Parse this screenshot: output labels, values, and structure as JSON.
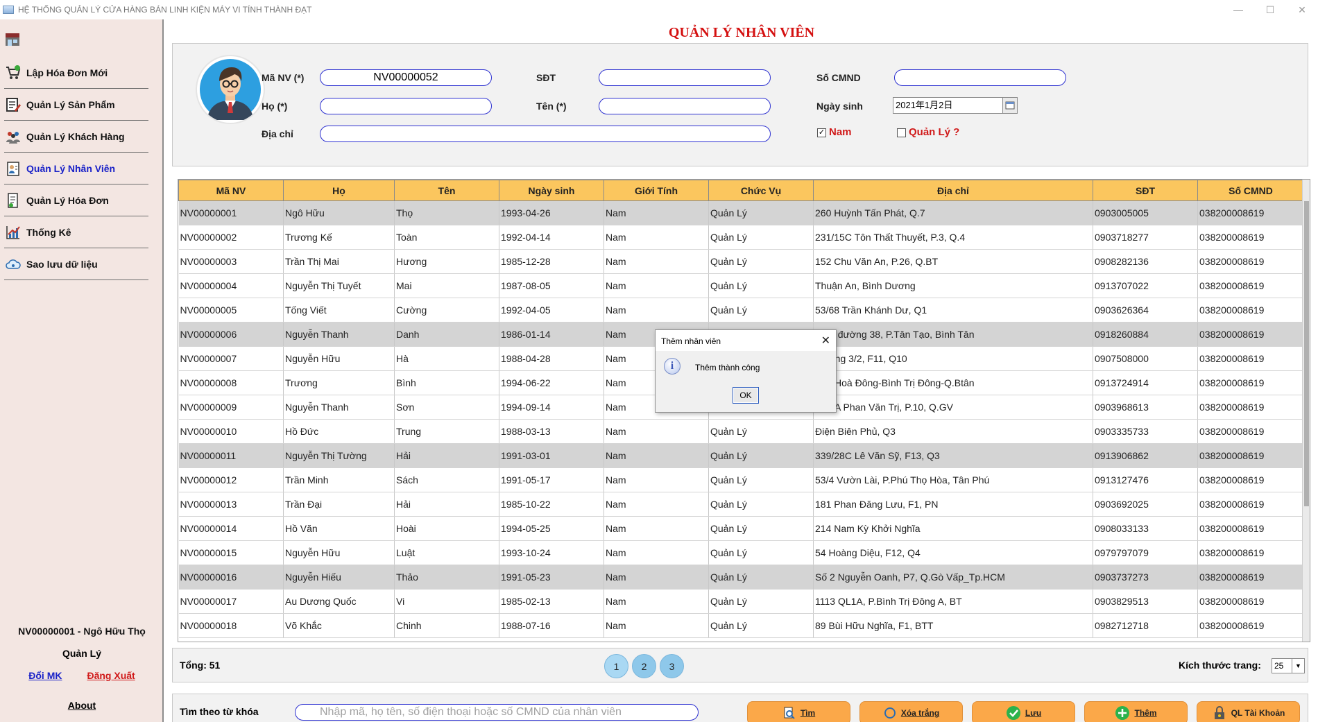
{
  "window": {
    "title": "HỆ THỐNG QUẢN LÝ CỬA HÀNG BÁN LINH KIỆN MÁY VI TÍNH THÀNH ĐẠT"
  },
  "sidebar": {
    "items": [
      {
        "label": "Lập Hóa Đơn Mới",
        "icon": "cart-icon"
      },
      {
        "label": "Quản Lý Sản Phẩm",
        "icon": "product-icon"
      },
      {
        "label": "Quản Lý Khách Hàng",
        "icon": "customers-icon"
      },
      {
        "label": "Quản Lý Nhân Viên",
        "icon": "employee-icon",
        "active": true
      },
      {
        "label": "Quản Lý Hóa Đơn",
        "icon": "invoice-icon"
      },
      {
        "label": "Thống Kê",
        "icon": "chart-icon"
      },
      {
        "label": "Sao lưu dữ liệu",
        "icon": "cloud-backup-icon"
      }
    ],
    "user": "NV00000001 - Ngô Hữu  Thọ",
    "role": "Quản Lý",
    "change_password": "Đổi MK",
    "logout": "Đăng Xuất",
    "about": "About"
  },
  "page": {
    "title": "QUẢN LÝ NHÂN VIÊN"
  },
  "form": {
    "ma_nv_label": "Mã NV (*)",
    "ma_nv_value": "NV00000052",
    "sdt_label": "SĐT",
    "sdt_value": "",
    "cmnd_label": "Số CMND",
    "cmnd_value": "",
    "ho_label": "Họ (*)",
    "ho_value": "",
    "ten_label": "Tên (*)",
    "ten_value": "",
    "ngay_sinh_label": "Ngày sinh",
    "ngay_sinh_value": "2021年1月2日",
    "dia_chi_label": "Địa chỉ",
    "dia_chi_value": "",
    "nam_label": "Nam",
    "nam_checked": true,
    "quan_ly_label": "Quản Lý ?",
    "quan_ly_checked": false
  },
  "table": {
    "columns": [
      "Mã NV",
      "Họ",
      "Tên",
      "Ngày sinh",
      "Giới Tính",
      "Chức Vụ",
      "Địa chỉ",
      "SĐT",
      "Số CMND"
    ],
    "rows": [
      [
        "NV00000001",
        "Ngô Hữu",
        "Thọ",
        "1993-04-26",
        "Nam",
        "Quản Lý",
        "260 Huỳnh Tấn Phát, Q.7",
        "0903005005",
        "038200008619"
      ],
      [
        "NV00000002",
        "Trương Kế",
        "Toàn",
        "1992-04-14",
        "Nam",
        "Quản Lý",
        "231/15C Tôn Thất Thuyết, P.3, Q.4",
        "0903718277",
        "038200008619"
      ],
      [
        "NV00000003",
        "Trần Thị Mai",
        "Hương",
        "1985-12-28",
        "Nam",
        "Quản Lý",
        "152 Chu Văn An, P.26, Q.BT",
        "0908282136",
        "038200008619"
      ],
      [
        "NV00000004",
        "Nguyễn Thị Tuyết",
        "Mai",
        "1987-08-05",
        "Nam",
        "Quản Lý",
        "Thuận An, Bình Dương",
        "0913707022",
        "038200008619"
      ],
      [
        "NV00000005",
        "Tống Viết",
        "Cường",
        "1992-04-05",
        "Nam",
        "Quản Lý",
        "53/68 Trần Khánh Dư, Q1",
        "0903626364",
        "038200008619"
      ],
      [
        "NV00000006",
        "Nguyễn Thanh",
        "Danh",
        "1986-01-14",
        "Nam",
        "Quản Lý",
        "Số 6 đường 38, P.Tân Tạo, Bình Tân",
        "0918260884",
        "038200008619"
      ],
      [
        "NV00000007",
        "Nguyễn Hữu",
        "Hà",
        "1988-04-28",
        "Nam",
        "Quản Lý",
        "Đường 3/2, F11, Q10",
        "0907508000",
        "038200008619"
      ],
      [
        "NV00000008",
        "Trương",
        "Bình",
        "1994-06-22",
        "Nam",
        "Quản Lý",
        "Tân Hoà Đông-Bình Trị Đông-Q.Btân",
        "0913724914",
        "038200008619"
      ],
      [
        "NV00000009",
        "Nguyễn Thanh",
        "Sơn",
        "1994-09-14",
        "Nam",
        "Quản Lý",
        "Khu A Phan Văn Trị, P.10, Q.GV",
        "0903968613",
        "038200008619"
      ],
      [
        "NV00000010",
        "Hồ Đức",
        "Trung",
        "1988-03-13",
        "Nam",
        "Quản Lý",
        "Điện Biên Phủ, Q3",
        "0903335733",
        "038200008619"
      ],
      [
        "NV00000011",
        "Nguyễn Thị Tường",
        "Hải",
        "1991-03-01",
        "Nam",
        "Quản Lý",
        "339/28C Lê Văn Sỹ, F13, Q3",
        "0913906862",
        "038200008619"
      ],
      [
        "NV00000012",
        "Trần Minh",
        "Sách",
        "1991-05-17",
        "Nam",
        "Quản Lý",
        "53/4 Vườn Lài, P.Phú Thọ Hòa, Tân Phú",
        "0913127476",
        "038200008619"
      ],
      [
        "NV00000013",
        "Trần Đại",
        "Hải",
        "1985-10-22",
        "Nam",
        "Quản Lý",
        "181 Phan Đăng Lưu, F1, PN",
        "0903692025",
        "038200008619"
      ],
      [
        "NV00000014",
        "Hồ Văn",
        "Hoài",
        "1994-05-25",
        "Nam",
        "Quản Lý",
        "214 Nam Kỳ Khởi Nghĩa",
        "0908033133",
        "038200008619"
      ],
      [
        "NV00000015",
        "Nguyễn Hữu",
        "Luật",
        "1993-10-24",
        "Nam",
        "Quản Lý",
        "54 Hoàng Diệu, F12, Q4",
        "0979797079",
        "038200008619"
      ],
      [
        "NV00000016",
        "Nguyễn Hiếu",
        "Thảo",
        "1991-05-23",
        "Nam",
        "Quản Lý",
        "Số 2 Nguyễn Oanh, P7, Q.Gò Vấp_Tp.HCM",
        "0903737273",
        "038200008619"
      ],
      [
        "NV00000017",
        "Au Dương Quốc",
        "Vi",
        "1985-02-13",
        "Nam",
        "Quản Lý",
        "1113 QL1A, P.Bình Trị Đông A, BT",
        "0903829513",
        "038200008619"
      ],
      [
        "NV00000018",
        "Võ Khắc",
        "Chinh",
        "1988-07-16",
        "Nam",
        "Quản Lý",
        "89 Bùi Hữu Nghĩa, F1, BTT",
        "0982712718",
        "038200008619"
      ]
    ]
  },
  "footer": {
    "total": "Tổng: 51",
    "pages": [
      "1",
      "2",
      "3"
    ],
    "page_size_label": "Kích thước trang:",
    "page_size_value": "25"
  },
  "search": {
    "label": "Tìm theo từ khóa",
    "placeholder": "Nhập mã, họ tên, số điện thoại hoặc số CMND của nhân viên"
  },
  "actions": {
    "find": "Tìm",
    "clear": "Xóa trắng",
    "save": "Lưu",
    "add": "Thêm",
    "accounts": "QL Tài Khoản"
  },
  "dialog": {
    "title": "Thêm nhân viên",
    "message": "Thêm thành công",
    "ok": "OK"
  },
  "colors": {
    "accent_red": "#d41010",
    "header_orange": "#fbc65e",
    "button_orange": "#fba849",
    "active_blue": "#1a22c8",
    "sidebar_bg": "#f3e6e2"
  }
}
